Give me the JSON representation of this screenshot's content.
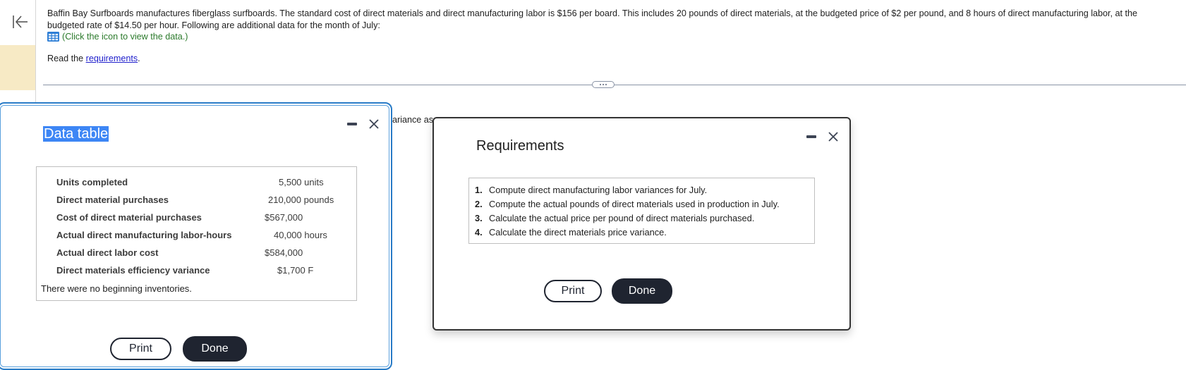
{
  "sidebar": {
    "collapse_icon": "collapse-left-icon"
  },
  "problem": {
    "text": "Baffin Bay Surfboards manufactures fiberglass surfboards. The standard cost of direct materials and direct manufacturing labor is $156 per board. This includes 20 pounds of direct materials, at the budgeted price of $2 per pound, and 8 hours of direct manufacturing labor, at the budgeted rate of $14.50 per hour. Following are additional data for the month of July:",
    "data_link_text": "(Click the icon to view the data.)",
    "data_icon": "table-grid-icon",
    "read_prefix": "Read the ",
    "requirements_link": "requirements",
    "read_suffix": ".",
    "background_fragment": "ariance as"
  },
  "data_modal": {
    "title": "Data table",
    "rows": [
      {
        "label": "Units completed",
        "value": "5,500 units"
      },
      {
        "label": "Direct material purchases",
        "value": "210,000 pounds"
      },
      {
        "label": "Cost of direct material purchases",
        "value": "$567,000"
      },
      {
        "label": "Actual direct manufacturing labor-hours",
        "value": "40,000 hours"
      },
      {
        "label": "Actual direct labor cost",
        "value": "$584,000"
      },
      {
        "label": "Direct materials efficiency variance",
        "value": "$1,700 F"
      }
    ],
    "note": "There were no beginning inventories.",
    "print_label": "Print",
    "done_label": "Done"
  },
  "requirements_modal": {
    "title": "Requirements",
    "items": [
      {
        "num": "1.",
        "text": "Compute direct manufacturing labor variances for July."
      },
      {
        "num": "2.",
        "text": "Compute the actual pounds of direct materials used in production in July."
      },
      {
        "num": "3.",
        "text": "Calculate the actual price per pound of direct materials purchased."
      },
      {
        "num": "4.",
        "text": "Calculate the direct materials price variance."
      }
    ],
    "print_label": "Print",
    "done_label": "Done"
  },
  "colors": {
    "accent_blue": "#2a7cc7",
    "title_highlight": "#3d86f5",
    "dark_button": "#1f2430",
    "link_green": "#2b7a2b",
    "sidebar_highlight": "#f7eac5"
  }
}
